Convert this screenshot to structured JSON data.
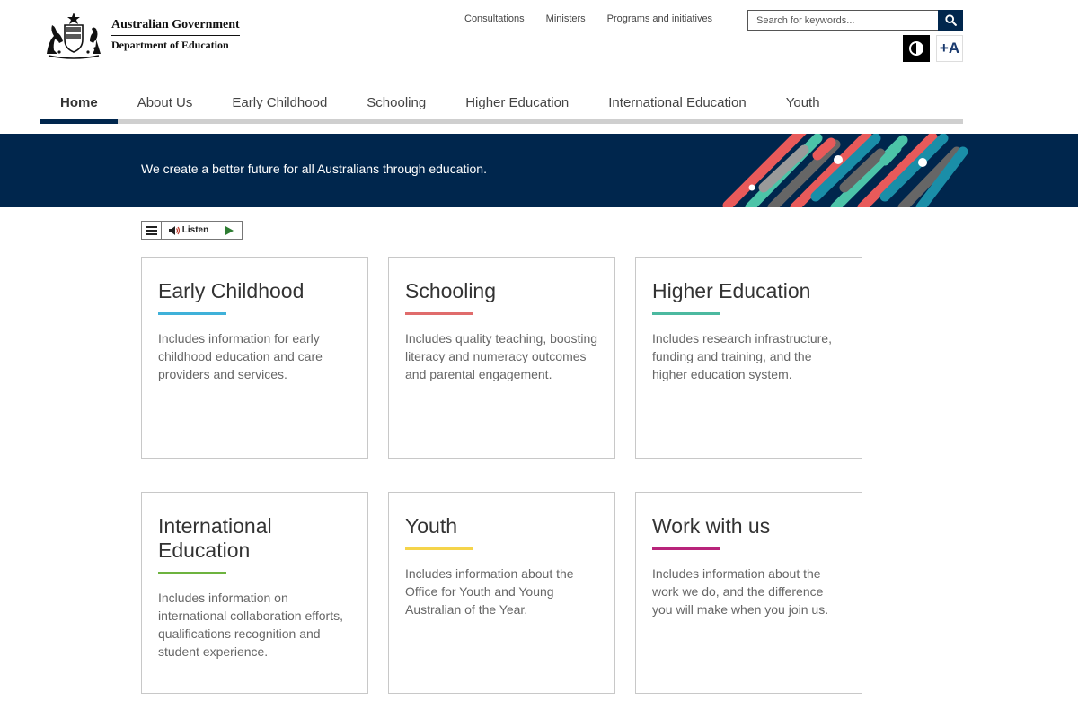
{
  "header": {
    "gov_name": "Australian Government",
    "dept_name": "Department of Education",
    "utility_links": [
      {
        "label": "Consultations"
      },
      {
        "label": "Ministers"
      },
      {
        "label": "Programs and initiatives"
      }
    ],
    "search": {
      "placeholder": "Search for keywords..."
    },
    "text_size_label": "+A"
  },
  "nav": {
    "items": [
      {
        "label": "Home",
        "active": true
      },
      {
        "label": "About Us"
      },
      {
        "label": "Early Childhood"
      },
      {
        "label": "Schooling"
      },
      {
        "label": "Higher Education"
      },
      {
        "label": "International Education"
      },
      {
        "label": "Youth"
      }
    ]
  },
  "banner": {
    "tagline": "We create a better future for all Australians through education."
  },
  "listen": {
    "label": "Listen"
  },
  "cards": [
    {
      "title": "Early Childhood",
      "description": "Includes information for early childhood education and care providers and services.",
      "accent": "#3fb1d9"
    },
    {
      "title": "Schooling",
      "description": "Includes quality teaching, boosting literacy and numeracy outcomes and parental engagement.",
      "accent": "#e06c6c"
    },
    {
      "title": "Higher Education",
      "description": "Includes research infrastructure, funding and training, and the higher education system.",
      "accent": "#4cb9a0"
    },
    {
      "title": "International Education",
      "description": "Includes information on international collaboration efforts, qualifications recognition and student experience.",
      "accent": "#6db33f"
    },
    {
      "title": "Youth",
      "description": "Includes information about the Office for Youth and Young Australian of the Year.",
      "accent": "#f5d44a"
    },
    {
      "title": "Work with us",
      "description": "Includes information about the work we do, and the difference you will make when you join us.",
      "accent": "#b8237a"
    }
  ],
  "colors": {
    "navy": "#00264d",
    "stripe_teal": "#4cc4a8",
    "stripe_blue": "#1a8ea8",
    "stripe_red": "#e85a5a",
    "stripe_grey": "#666666"
  }
}
